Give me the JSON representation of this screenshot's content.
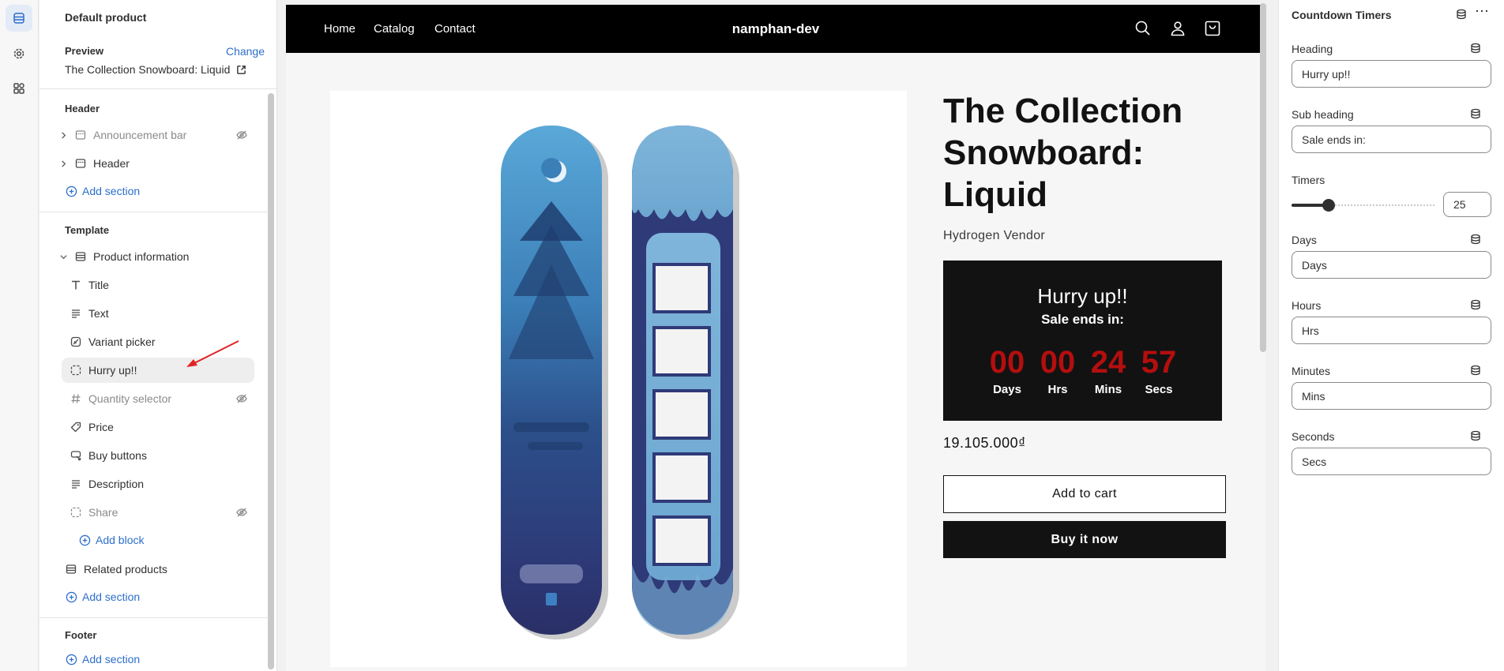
{
  "rail": {
    "items": [
      {
        "icon": "sections-icon",
        "active": true
      },
      {
        "icon": "gear-icon",
        "active": false
      },
      {
        "icon": "apps-icon",
        "active": false
      }
    ]
  },
  "sidebar": {
    "title": "Default product",
    "preview_label": "Preview",
    "change_label": "Change",
    "preview_value": "The Collection Snowboard: Liquid",
    "header_group": "Header",
    "header_items": [
      {
        "label": "Announcement bar",
        "hidden": true
      },
      {
        "label": "Header",
        "hidden": false
      }
    ],
    "add_section": "Add section",
    "template_group": "Template",
    "product_info": "Product information",
    "blocks": [
      {
        "label": "Title",
        "icon": "text-icon",
        "hidden": false
      },
      {
        "label": "Text",
        "icon": "paragraph-icon",
        "hidden": false
      },
      {
        "label": "Variant picker",
        "icon": "variant-icon",
        "hidden": false
      },
      {
        "label": "Hurry up!!",
        "icon": "block-icon",
        "hidden": false,
        "selected": true
      },
      {
        "label": "Quantity selector",
        "icon": "hash-icon",
        "hidden": true
      },
      {
        "label": "Price",
        "icon": "price-tag-icon",
        "hidden": false
      },
      {
        "label": "Buy buttons",
        "icon": "cart-icon",
        "hidden": false
      },
      {
        "label": "Description",
        "icon": "paragraph-icon",
        "hidden": false
      },
      {
        "label": "Share",
        "icon": "block-icon",
        "hidden": true
      }
    ],
    "add_block": "Add block",
    "related_products": "Related products",
    "add_section_2": "Add section",
    "footer_group": "Footer",
    "add_section_3": "Add section"
  },
  "store": {
    "nav_links": [
      "Home",
      "Catalog",
      "Contact"
    ],
    "brand": "namphan-dev",
    "product_title": "The Collection Snowboard: Liquid",
    "vendor": "Hydrogen Vendor",
    "timer": {
      "heading": "Hurry up!!",
      "sub_heading": "Sale ends in:",
      "units": [
        {
          "value": "00",
          "label": "Days"
        },
        {
          "value": "00",
          "label": "Hrs"
        },
        {
          "value": "24",
          "label": "Mins"
        },
        {
          "value": "57",
          "label": "Secs"
        }
      ]
    },
    "price": "19.105.000₫",
    "add_to_cart": "Add to cart",
    "buy_now": "Buy it now"
  },
  "panel": {
    "title": "Countdown Timers",
    "more": "⋯",
    "heading_label": "Heading",
    "heading_value": "Hurry up!!",
    "subheading_label": "Sub heading",
    "subheading_value": "Sale ends in:",
    "timers_label": "Timers",
    "timers_value": "25",
    "days_label": "Days",
    "days_value": "Days",
    "hours_label": "Hours",
    "hours_value": "Hrs",
    "minutes_label": "Minutes",
    "minutes_value": "Mins",
    "seconds_label": "Seconds",
    "seconds_value": "Secs"
  },
  "colors": {
    "accent": "#2c6ecb",
    "timer_digits": "#b40e0e",
    "timer_bg": "#121212",
    "nav_bg": "#000000"
  }
}
